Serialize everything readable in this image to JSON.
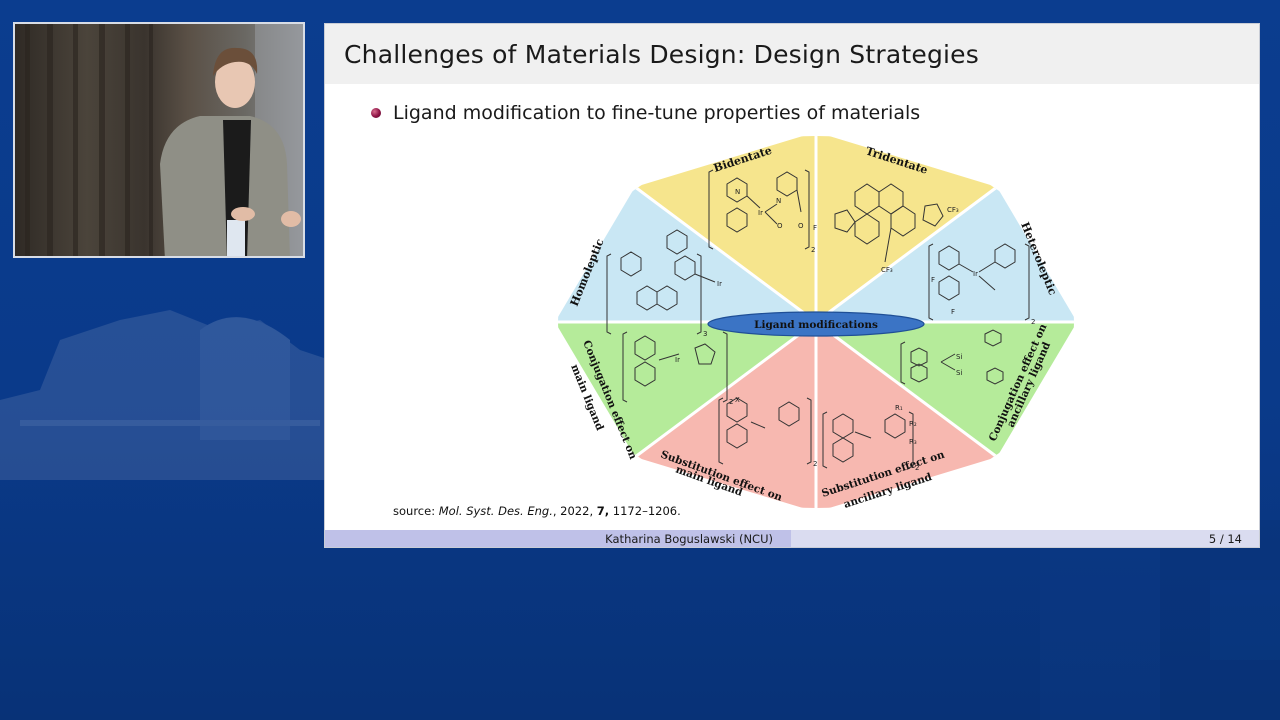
{
  "slide": {
    "title": "Challenges of Materials Design: Design Strategies",
    "bullet": "Ligand modification to fine-tune properties of materials",
    "source": {
      "prefix": "source:",
      "journal": "Mol. Syst. Des. Eng.",
      "year": "2022,",
      "volume": "7,",
      "pages": "1172–1206."
    },
    "footer": {
      "author": "Katharina Boguslawski (NCU)",
      "page": "5 / 14"
    }
  },
  "diagram": {
    "center_label": "Ligand modifications",
    "segments": [
      {
        "label": "Bidentate",
        "color": "#f6e58d"
      },
      {
        "label": "Tridentate",
        "color": "#f6e58d"
      },
      {
        "label": "Heteroleptic",
        "color": "#c9e7f4"
      },
      {
        "label": "Homoleptic",
        "color": "#c9e7f4"
      },
      {
        "label_line1": "Conjugation effect on",
        "label_line2": "main ligand",
        "color": "#b5eb9a"
      },
      {
        "label_line1": "Conjugation effect on",
        "label_line2": "ancillary ligand",
        "color": "#b5eb9a"
      },
      {
        "label_line1": "Substitution effect on",
        "label_line2": "main ligand",
        "color": "#f7b8b0"
      },
      {
        "label_line1": "Substitution effect on",
        "label_line2": "ancillary ligand",
        "color": "#f7b8b0"
      }
    ],
    "atoms": {
      "ir": "Ir",
      "n": "N",
      "o": "O",
      "f": "F",
      "cf3": "CF₃",
      "x": "X",
      "r1": "R₁",
      "r2": "R₂",
      "r3": "R₃",
      "si": "Si",
      "sub2": "2",
      "sub3": "3"
    }
  }
}
